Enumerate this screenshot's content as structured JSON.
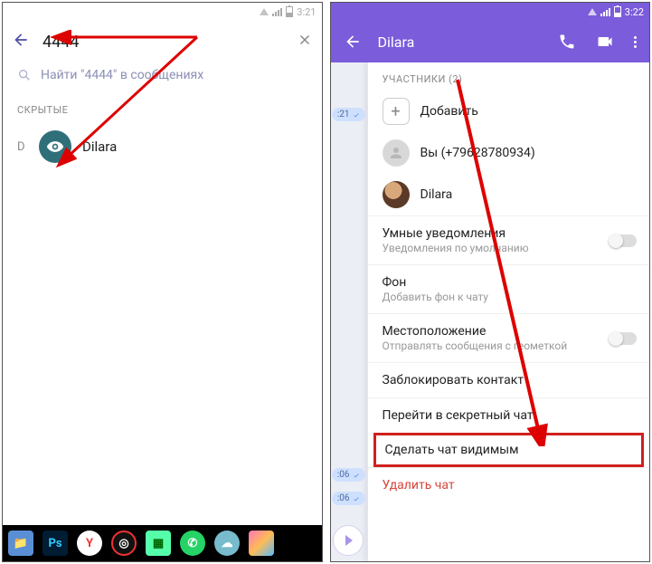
{
  "left": {
    "status_time": "3:21",
    "search_value": "4444",
    "search_hint": "Найти \"4444\" в сообщениях",
    "section_hidden": "СКРЫТЫЕ",
    "letter": "D",
    "contact_name": "Dilara"
  },
  "right": {
    "status_time": "3:22",
    "header_title": "Dilara",
    "participants_label": "УЧАСТНИКИ (2)",
    "add_label": "Добавить",
    "you_label": "Вы (+79628780934)",
    "member_name": "Dilara",
    "smart_notif_title": "Умные уведомления",
    "smart_notif_sub": "Уведомления по умолчанию",
    "bg_title": "Фон",
    "bg_sub": "Добавить фон к чату",
    "loc_title": "Местоположение",
    "loc_sub": "Отправлять сообщения с геометкой",
    "block_title": "Заблокировать контакт",
    "secret_title": "Перейти в секретный чат",
    "visible_title": "Сделать чат видимым",
    "delete_title": "Удалить чат",
    "bubble1": ":21",
    "bubble2": ":06",
    "bubble3": ":06"
  }
}
